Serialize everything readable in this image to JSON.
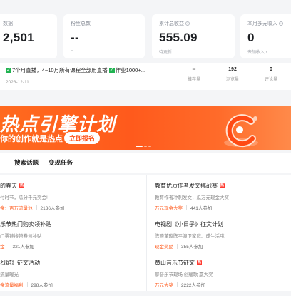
{
  "stats": [
    {
      "label": "数据",
      "value": "2,501",
      "sub": ""
    },
    {
      "label": "粉丝总数",
      "value": "--",
      "sub": "--"
    },
    {
      "label": "累计总收益",
      "value": "555.09",
      "sub": "待更新"
    },
    {
      "label": "本月多元收入",
      "value": "0",
      "sub": "去领收入 ›"
    }
  ],
  "work": {
    "title_parts": [
      "7个月直播，4~10月所有课程全部用直播",
      "作业1000+..."
    ],
    "date": "2023-12-11",
    "metrics": [
      {
        "value": "--",
        "label": "推荐量"
      },
      {
        "value": "192",
        "label": "浏览量"
      },
      {
        "value": "0",
        "label": "评论量"
      }
    ]
  },
  "banner": {
    "headline": "热点引擎计划",
    "slogan": "你的创作就是热点",
    "button": "立即报名"
  },
  "tabs": [
    "搜索话题",
    "变现任务"
  ],
  "activities": [
    {
      "title": "的春天",
      "hot": true,
      "desc": "付时节，瓜分千元奖金!",
      "prize": "金：百万流量池",
      "count": "2136人参加"
    },
    {
      "title": "教育优质作者发文挑战赛",
      "hot": true,
      "desc": "教育作者冲刺发文，瓜万元现金大奖",
      "prize": "万元现金大奖",
      "count": "441人参加"
    },
    {
      "title": "乐节热门购卖领补贴",
      "hot": false,
      "desc": "门票链接带券领补贴",
      "prize": "金",
      "count": "321人参加"
    },
    {
      "title": "电视剧《小日子》征文计划",
      "hot": false,
      "desc": "陈晓董璇陈平演卫家庭、成生活哦",
      "prize": "现金奖励",
      "count": "355人参加"
    },
    {
      "title": "烈焰》征文活动",
      "hot": false,
      "desc": "流量曝光",
      "prize": "金流量福利",
      "count": "298人参加"
    },
    {
      "title": "黄山音乐节征文",
      "hot": true,
      "desc": "聊音乐节现场 创耀歌 赢大奖",
      "prize": "万元大奖",
      "count": "2222人参加"
    }
  ],
  "colors": {
    "accent": "#ff5a1c",
    "check": "#21b351",
    "hot_badge": "#ff3b30"
  }
}
